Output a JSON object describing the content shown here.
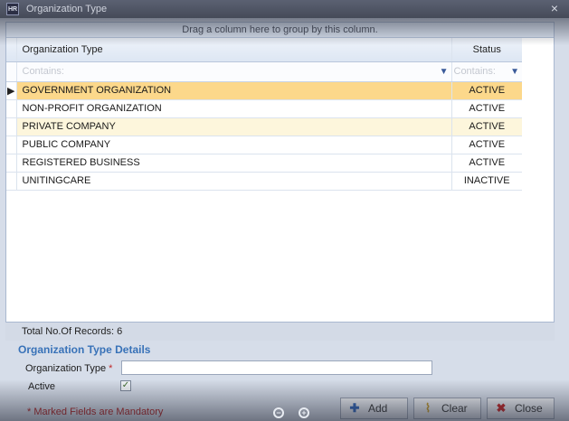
{
  "window": {
    "title": "Organization Type",
    "app_icon_text": "HR",
    "close_glyph": "×"
  },
  "grid": {
    "group_hint": "Drag a column here to group by this column.",
    "columns": [
      {
        "header": "Organization Type",
        "filter_placeholder": "Contains:"
      },
      {
        "header": "Status",
        "filter_placeholder": "Contains:"
      }
    ],
    "current_row_indicator": "▶",
    "rows": [
      {
        "type": "GOVERNMENT ORGANIZATION",
        "status": "ACTIVE",
        "selected": true
      },
      {
        "type": "NON-PROFIT ORGANIZATION",
        "status": "ACTIVE",
        "selected": false
      },
      {
        "type": "PRIVATE COMPANY",
        "status": "ACTIVE",
        "selected": false
      },
      {
        "type": "PUBLIC COMPANY",
        "status": "ACTIVE",
        "selected": false
      },
      {
        "type": "REGISTERED BUSINESS",
        "status": "ACTIVE",
        "selected": false
      },
      {
        "type": "UNITINGCARE",
        "status": "INACTIVE",
        "selected": false
      }
    ]
  },
  "footer": {
    "records_text": "Total No.Of Records: 6"
  },
  "details": {
    "title": "Organization Type Details",
    "type_label": "Organization Type",
    "required_marker": "*",
    "type_value": "",
    "active_label": "Active",
    "active_checked": true,
    "mandatory_note": "* Marked Fields are Mandatory"
  },
  "buttons": {
    "add_label": "Add",
    "clear_label": "Clear",
    "close_label": "Close"
  },
  "colors": {
    "selected_row": "#fcd88b",
    "alt_row": "#fdf6dc",
    "details_title": "#3872b8",
    "mandatory_text": "#b02020"
  }
}
